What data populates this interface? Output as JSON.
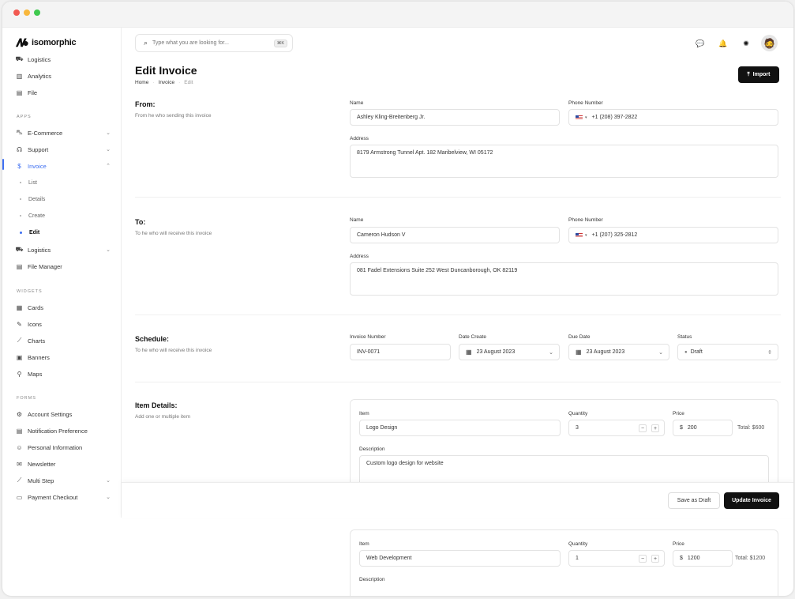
{
  "brand": {
    "name": "isomorphic"
  },
  "sidebar": {
    "top_items": [
      {
        "label": "Logistics",
        "icon": "truck-icon"
      },
      {
        "label": "Analytics",
        "icon": "chart-icon"
      },
      {
        "label": "File",
        "icon": "file-icon"
      }
    ],
    "section_apps": "APPS",
    "apps": [
      {
        "label": "E-Commerce",
        "icon": "cart-icon"
      },
      {
        "label": "Support",
        "icon": "headset-icon"
      },
      {
        "label": "Invoice",
        "icon": "dollar-icon"
      }
    ],
    "invoice_sub": [
      "List",
      "Details",
      "Create",
      "Edit"
    ],
    "apps2": [
      {
        "label": "Logistics",
        "icon": "truck-icon"
      },
      {
        "label": "File Manager",
        "icon": "file-icon"
      }
    ],
    "section_widgets": "WIDGETS",
    "widgets": [
      {
        "label": "Cards",
        "icon": "grid-icon"
      },
      {
        "label": "Icons",
        "icon": "feather-icon"
      },
      {
        "label": "Charts",
        "icon": "line-chart-icon"
      },
      {
        "label": "Banners",
        "icon": "banner-icon"
      },
      {
        "label": "Maps",
        "icon": "map-icon"
      }
    ],
    "section_forms": "FORMS",
    "forms": [
      {
        "label": "Account Settings",
        "icon": "user-settings-icon"
      },
      {
        "label": "Notification Preference",
        "icon": "bell-doc-icon"
      },
      {
        "label": "Personal Information",
        "icon": "person-icon"
      },
      {
        "label": "Newsletter",
        "icon": "mail-icon"
      },
      {
        "label": "Multi Step",
        "icon": "steps-icon"
      },
      {
        "label": "Payment Checkout",
        "icon": "card-icon"
      }
    ]
  },
  "search": {
    "placeholder": "Type what you are looking for...",
    "shortcut": "⌘K"
  },
  "page": {
    "title": "Edit Invoice",
    "breadcrumb": [
      "Home",
      "Invoice",
      "Edit"
    ],
    "import_label": "Import"
  },
  "from": {
    "title": "From:",
    "desc": "From he who sending this invoice",
    "name_label": "Name",
    "name": "Ashley Kling-Breitenberg Jr.",
    "phone_label": "Phone Number",
    "phone": "+1 (208) 397-2822",
    "address_label": "Address",
    "address": "8179 Armstrong Tunnel Apt. 182 Maribelview, WI 05172"
  },
  "to": {
    "title": "To:",
    "desc": "To he who will receive this invoice",
    "name_label": "Name",
    "name": "Cameron Hudson V",
    "phone_label": "Phone Number",
    "phone": "+1 (207) 325-2812",
    "address_label": "Address",
    "address": "081 Fadel Extensions Suite 252 West Duncanborough, OK 82119"
  },
  "schedule": {
    "title": "Schedule:",
    "desc": "To he who will receive this invoice",
    "invoice_label": "Invoice Number",
    "invoice": "INV-0071",
    "date_create_label": "Date Create",
    "date_create": "23 August 2023",
    "due_label": "Due Date",
    "due": "23 August 2023",
    "status_label": "Status",
    "status": "Draft"
  },
  "items": {
    "title": "Item Details:",
    "desc": "Add one or multiple item",
    "list": [
      {
        "item_label": "Item",
        "item": "Logo Design",
        "qty_label": "Quantity",
        "qty": "3",
        "price_label": "Price",
        "currency": "$",
        "price": "200",
        "total": "Total: $600",
        "desc_label": "Description",
        "desc": "Custom logo design for website"
      },
      {
        "item_label": "Item",
        "item": "Web Development",
        "qty_label": "Quantity",
        "qty": "1",
        "price_label": "Price",
        "currency": "$",
        "price": "1200",
        "total": "Total: $1200",
        "desc_label": "Description",
        "desc": ""
      }
    ]
  },
  "footer": {
    "draft_label": "Save as Draft",
    "update_label": "Update Invoice"
  }
}
